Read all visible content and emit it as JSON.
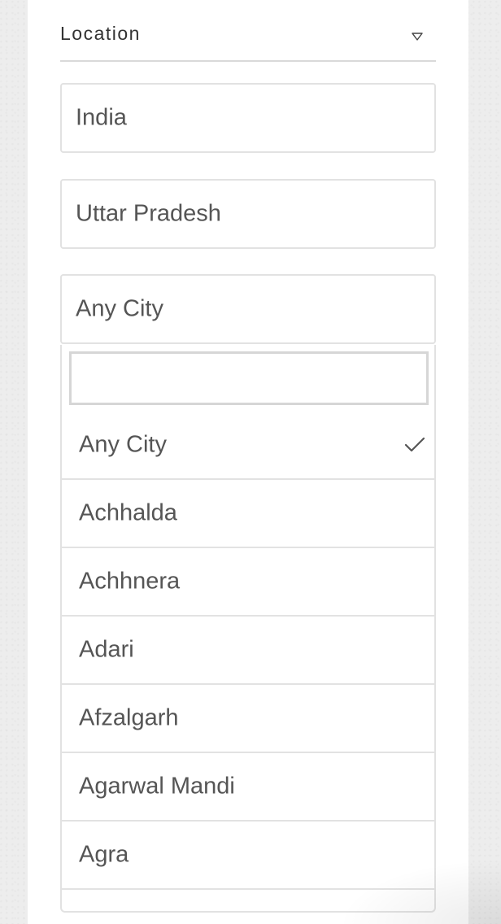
{
  "location_section": {
    "title": "Location",
    "toggle_icon": "chevron-down-icon"
  },
  "country_select": {
    "value": "India"
  },
  "state_select": {
    "value": "Uttar Pradesh"
  },
  "city_select": {
    "value": "Any City",
    "open": true
  },
  "city_dropdown": {
    "search_value": "",
    "selected_check_icon": "check-icon",
    "options": [
      {
        "label": "Any City",
        "selected": true
      },
      {
        "label": "Achhalda",
        "selected": false
      },
      {
        "label": "Achhnera",
        "selected": false
      },
      {
        "label": "Adari",
        "selected": false
      },
      {
        "label": "Afzalgarh",
        "selected": false
      },
      {
        "label": "Agarwal Mandi",
        "selected": false
      },
      {
        "label": "Agra",
        "selected": false
      },
      {
        "label": "",
        "selected": false
      }
    ]
  }
}
